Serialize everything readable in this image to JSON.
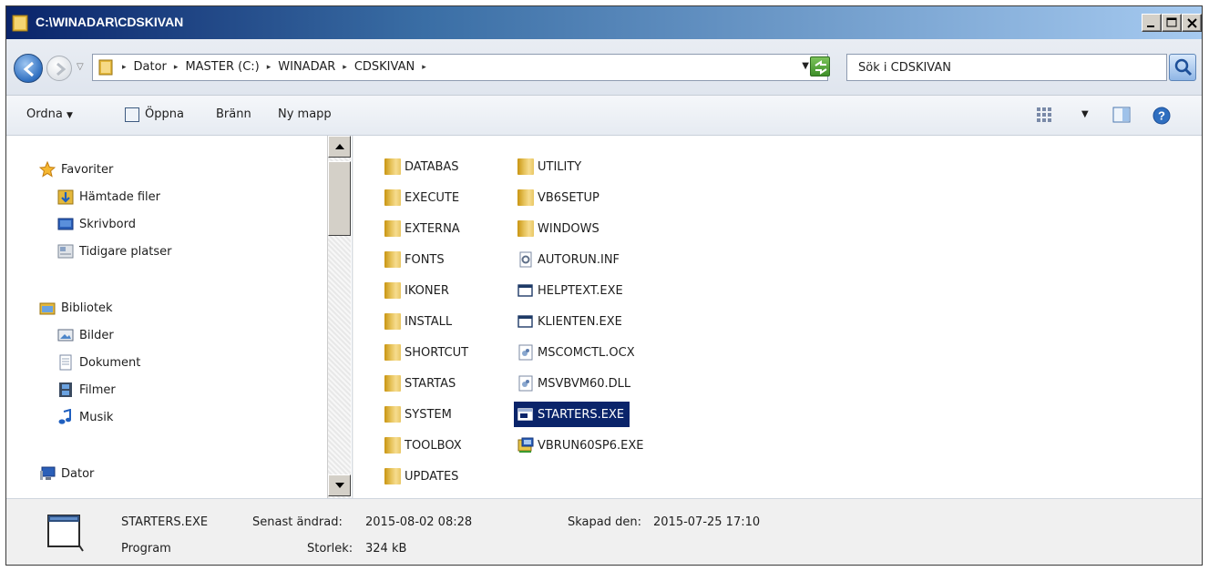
{
  "window": {
    "title": "C:\\WINADAR\\CDSKIVAN"
  },
  "address": {
    "crumbs": [
      "Dator",
      "MASTER (C:)",
      "WINADAR",
      "CDSKIVAN"
    ],
    "search_placeholder": "Sök i CDSKIVAN"
  },
  "toolbar": {
    "organize": "Ordna",
    "open": "Öppna",
    "burn": "Bränn",
    "new_folder": "Ny mapp"
  },
  "nav": {
    "favorites": "Favoriter",
    "downloads": "Hämtade filer",
    "desktop": "Skrivbord",
    "recent": "Tidigare platser",
    "libraries": "Bibliotek",
    "pictures": "Bilder",
    "documents": "Dokument",
    "videos": "Filmer",
    "music": "Musik",
    "computer": "Dator"
  },
  "files": {
    "col1": [
      "DATABAS",
      "EXECUTE",
      "EXTERNA",
      "FONTS",
      "IKONER",
      "INSTALL",
      "SHORTCUT",
      "STARTAS",
      "SYSTEM",
      "TOOLBOX",
      "UPDATES"
    ],
    "col2": [
      "UTILITY",
      "VB6SETUP",
      "WINDOWS",
      "AUTORUN.INF",
      "HELPTEXT.EXE",
      "KLIENTEN.EXE",
      "MSCOMCTL.OCX",
      "MSVBVM60.DLL",
      "STARTERS.EXE",
      "VBRUN60SP6.EXE"
    ],
    "col2_types": [
      "folder",
      "folder",
      "folder",
      "inf",
      "exe",
      "exe",
      "ocx",
      "dll",
      "exe",
      "setup"
    ],
    "selected": "STARTERS.EXE"
  },
  "details": {
    "name": "STARTERS.EXE",
    "modified_label": "Senast ändrad:",
    "modified_value": "2015-08-02 08:28",
    "created_label": "Skapad den:",
    "created_value": "2015-07-25 17:10",
    "type": "Program",
    "size_label": "Storlek:",
    "size_value": "324 kB"
  },
  "colors": {
    "selection": "#0a246a",
    "title_start": "#0a246a",
    "title_end": "#a6caf0"
  }
}
